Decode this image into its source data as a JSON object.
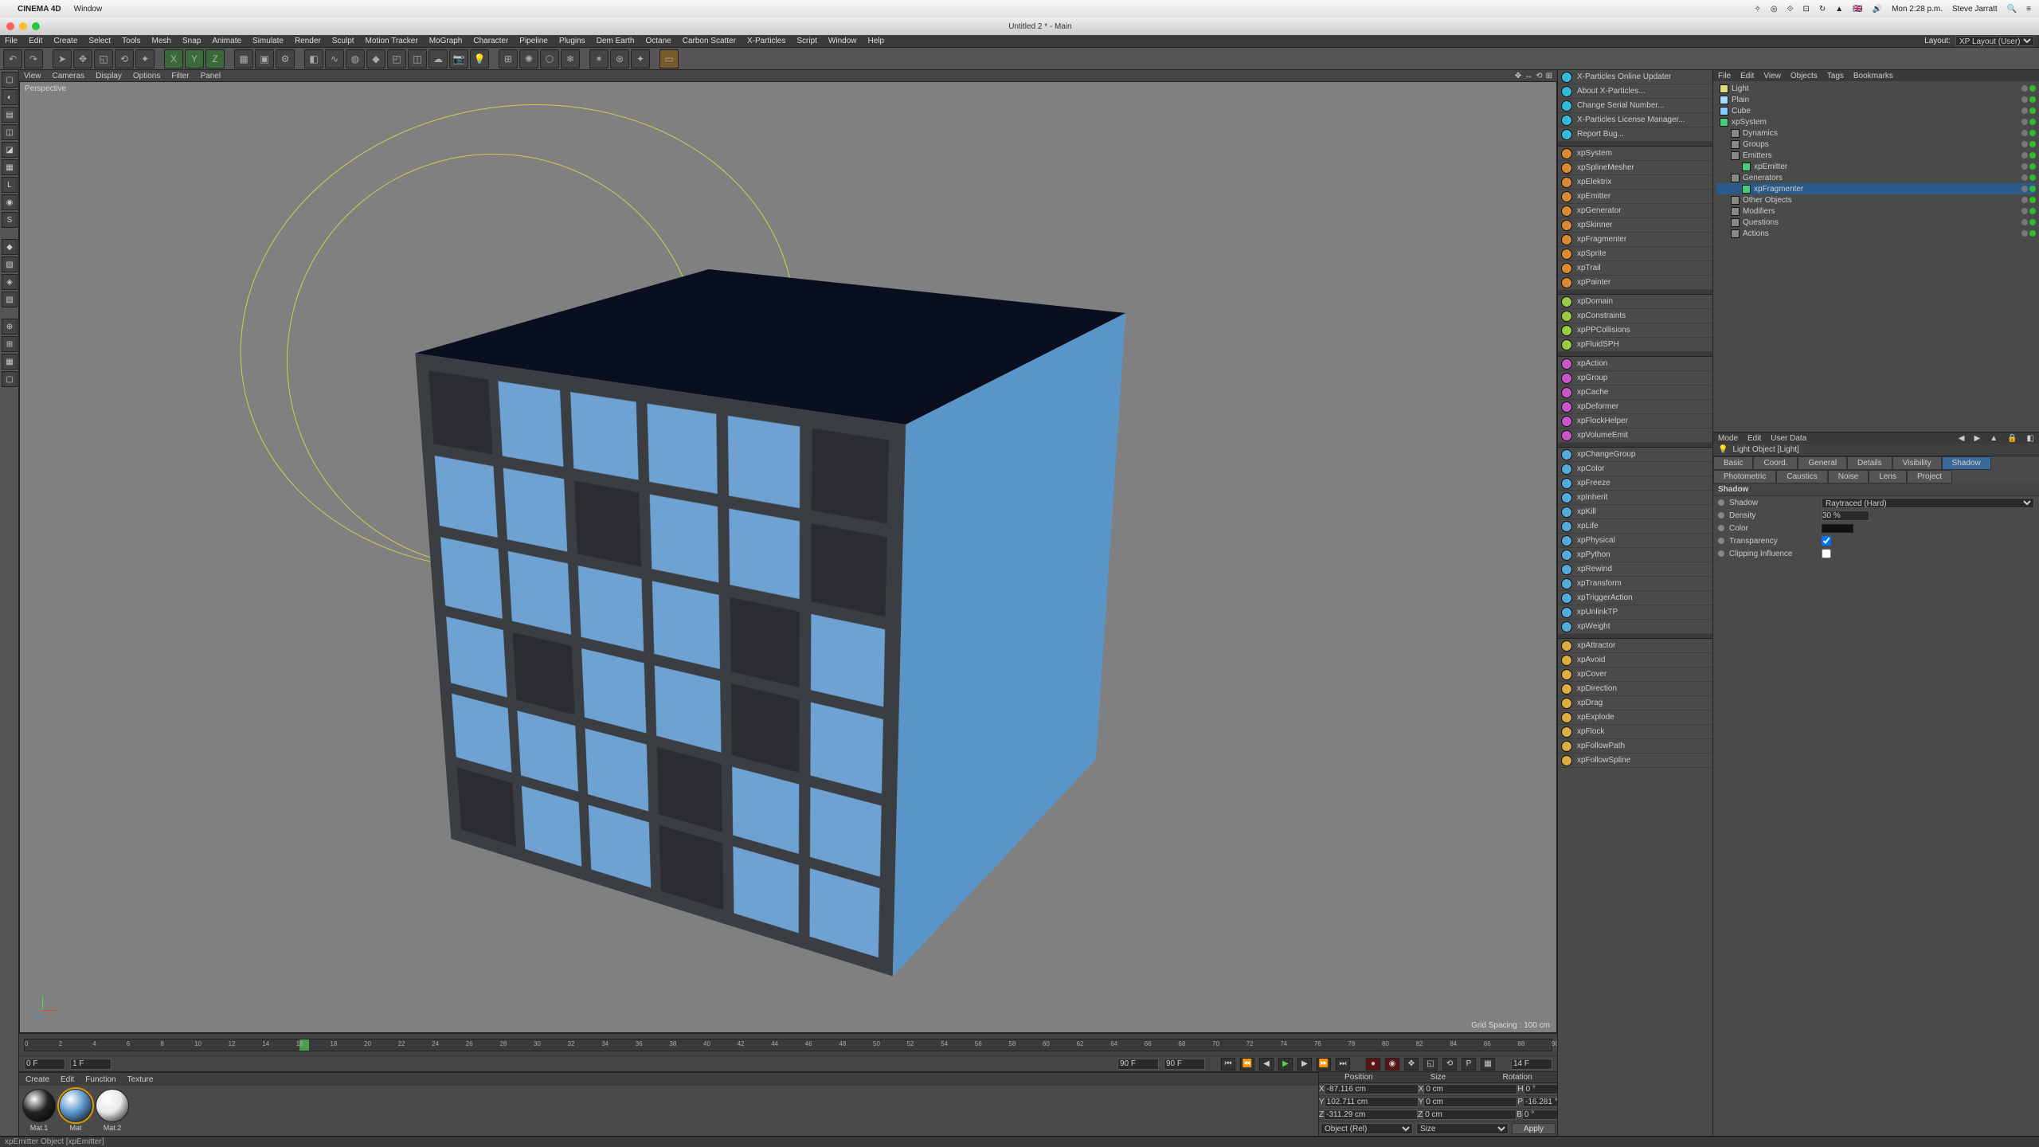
{
  "mac": {
    "app": "CINEMA 4D",
    "menus": [
      "Window"
    ],
    "right": [
      "Mon 2:28 p.m.",
      "Steve Jarratt"
    ]
  },
  "window": {
    "title": "Untitled 2 * - Main"
  },
  "mainmenu": [
    "File",
    "Edit",
    "Create",
    "Select",
    "Tools",
    "Mesh",
    "Snap",
    "Animate",
    "Simulate",
    "Render",
    "Sculpt",
    "Motion Tracker",
    "MoGraph",
    "Character",
    "Pipeline",
    "Plugins",
    "Dem Earth",
    "Octane",
    "Carbon Scatter",
    "X-Particles",
    "Script",
    "Window",
    "Help"
  ],
  "layout": {
    "label": "Layout:",
    "value": "XP Layout (User)"
  },
  "viewmenu": [
    "View",
    "Cameras",
    "Display",
    "Options",
    "Filter",
    "Panel"
  ],
  "viewport": {
    "label": "Perspective",
    "gridspacing": "Grid Spacing : 100 cm"
  },
  "timeline": {
    "f0": "0 F",
    "f1": "1 F",
    "end": "90 F",
    "cur": "14 F"
  },
  "mat": {
    "tabs": [
      "Create",
      "Edit",
      "Function",
      "Texture"
    ],
    "items": [
      {
        "name": "Mat.1",
        "col": "#222"
      },
      {
        "name": "Mat",
        "col": "#5a95c9"
      },
      {
        "name": "Mat.2",
        "col": "#e8e8e8"
      }
    ]
  },
  "coords": {
    "headers": [
      "Position",
      "Size",
      "Rotation"
    ],
    "rows": [
      {
        "a": "X",
        "pv": "-87.116 cm",
        "sa": "X",
        "sv": "0 cm",
        "ra": "H",
        "rv": "0 °"
      },
      {
        "a": "Y",
        "pv": "102.711 cm",
        "sa": "Y",
        "sv": "0 cm",
        "ra": "P",
        "rv": "-16.281 °"
      },
      {
        "a": "Z",
        "pv": "-311.29 cm",
        "sa": "Z",
        "sv": "0 cm",
        "ra": "B",
        "rv": "0 °"
      }
    ],
    "mode": "Object (Rel)",
    "sizemode": "Size",
    "apply": "Apply"
  },
  "xp": {
    "groups": [
      [
        "X-Particles Online Updater",
        "About X-Particles...",
        "Change Serial Number...",
        "X-Particles License Manager...",
        "Report Bug..."
      ],
      [
        "xpSystem",
        "xpSplineMesher",
        "xpElektrix",
        "xpEmitter",
        "xpGenerator",
        "xpSkinner",
        "xpFragmenter",
        "xpSprite",
        "xpTrail",
        "xpPainter"
      ],
      [
        "xpDomain",
        "xpConstraints",
        "xpPPCollisions",
        "xpFluidSPH"
      ],
      [
        "xpAction",
        "xpGroup",
        "xpCache",
        "xpDeformer",
        "xpFlockHelper",
        "xpVolumeEmit"
      ],
      [
        "xpChangeGroup",
        "xpColor",
        "xpFreeze",
        "xpInherit",
        "xpKill",
        "xpLife",
        "xpPhysical",
        "xpPython",
        "xpRewind",
        "xpTransform",
        "xpTriggerAction",
        "xpUnlinkTP",
        "xpWeight"
      ],
      [
        "xpAttractor",
        "xpAvoid",
        "xpCover",
        "xpDirection",
        "xpDrag",
        "xpExplode",
        "xpFlock",
        "xpFollowPath",
        "xpFollowSpline"
      ]
    ]
  },
  "objmgr": {
    "menu": [
      "File",
      "Edit",
      "View",
      "Objects",
      "Tags",
      "Bookmarks"
    ],
    "tree": [
      {
        "d": 0,
        "n": "Light",
        "t": "light"
      },
      {
        "d": 0,
        "n": "Plain",
        "t": "eff"
      },
      {
        "d": 0,
        "n": "Cube",
        "t": "cube"
      },
      {
        "d": 0,
        "n": "xpSystem",
        "t": "xp"
      },
      {
        "d": 1,
        "n": "Dynamics",
        "t": "grp"
      },
      {
        "d": 1,
        "n": "Groups",
        "t": "grp"
      },
      {
        "d": 1,
        "n": "Emitters",
        "t": "grp"
      },
      {
        "d": 2,
        "n": "xpEmitter",
        "t": "xp"
      },
      {
        "d": 1,
        "n": "Generators",
        "t": "grp"
      },
      {
        "d": 2,
        "n": "xpFragmenter",
        "t": "xp",
        "sel": true
      },
      {
        "d": 1,
        "n": "Other Objects",
        "t": "grp"
      },
      {
        "d": 1,
        "n": "Modifiers",
        "t": "grp"
      },
      {
        "d": 1,
        "n": "Questions",
        "t": "grp"
      },
      {
        "d": 1,
        "n": "Actions",
        "t": "grp"
      }
    ]
  },
  "attr": {
    "menu": [
      "Mode",
      "Edit",
      "User Data"
    ],
    "title": "Light Object [Light]",
    "tabs1": [
      "Basic",
      "Coord.",
      "General",
      "Details",
      "Visibility",
      "Shadow",
      "Photometric",
      "Caustics",
      "Noise",
      "Lens"
    ],
    "tabs2": [
      "Project"
    ],
    "activeTab": "Shadow",
    "section": "Shadow",
    "fields": {
      "shadow_lbl": "Shadow",
      "shadow_val": "Raytraced (Hard)",
      "density_lbl": "Density",
      "density_val": "30 %",
      "color_lbl": "Color",
      "transparency_lbl": "Transparency",
      "clip_lbl": "Clipping Influence"
    }
  },
  "status": "xpEmitter Object [xpEmitter]"
}
